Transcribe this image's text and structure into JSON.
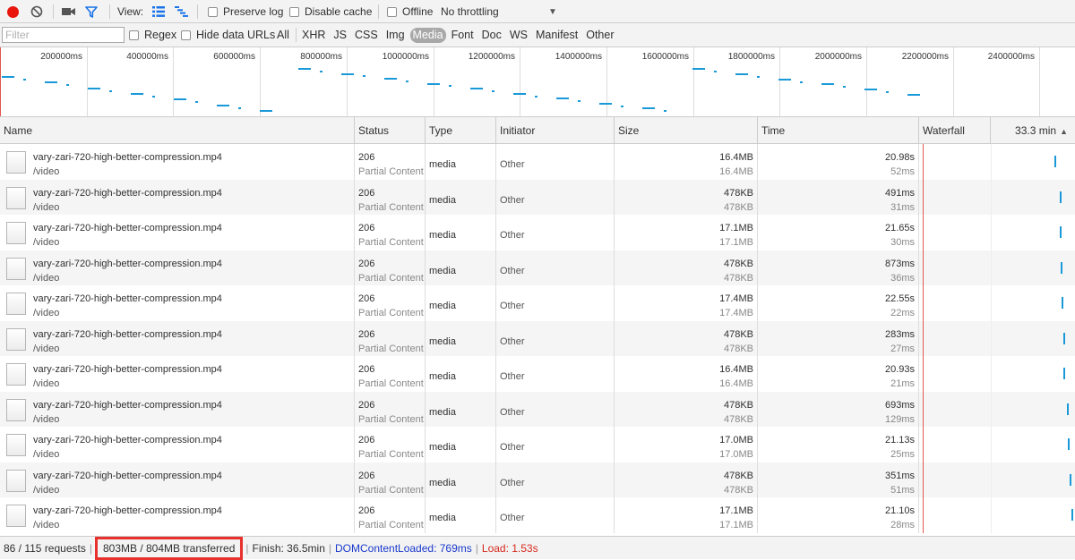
{
  "toolbar": {
    "view_label": "View:",
    "preserve_log_label": "Preserve log",
    "disable_cache_label": "Disable cache",
    "offline_label": "Offline",
    "throttling_value": "No throttling"
  },
  "filter_bar": {
    "filter_placeholder": "Filter",
    "regex_label": "Regex",
    "hide_data_urls_label": "Hide data URLs",
    "type_filters": [
      "All",
      "XHR",
      "JS",
      "CSS",
      "Img",
      "Media",
      "Font",
      "Doc",
      "WS",
      "Manifest",
      "Other"
    ],
    "active_type": "Media"
  },
  "overview": {
    "ticks": [
      "200000ms",
      "400000ms",
      "600000ms",
      "800000ms",
      "1000000ms",
      "1200000ms",
      "1400000ms",
      "1600000ms",
      "1800000ms",
      "2000000ms",
      "2200000ms",
      "2400000ms"
    ]
  },
  "table": {
    "columns": {
      "name": "Name",
      "status": "Status",
      "type": "Type",
      "initiator": "Initiator",
      "size": "Size",
      "time": "Time",
      "waterfall": "Waterfall",
      "duration": "33.3 min"
    },
    "rows": [
      {
        "name": "vary-zari-720-high-better-compression.mp4",
        "path": "/video",
        "status": "206",
        "status_text": "Partial Content",
        "type": "media",
        "initiator": "Other",
        "size": "16.4MB",
        "content": "16.4MB",
        "time": "20.98s",
        "latency": "52ms"
      },
      {
        "name": "vary-zari-720-high-better-compression.mp4",
        "path": "/video",
        "status": "206",
        "status_text": "Partial Content",
        "type": "media",
        "initiator": "Other",
        "size": "478KB",
        "content": "478KB",
        "time": "491ms",
        "latency": "31ms"
      },
      {
        "name": "vary-zari-720-high-better-compression.mp4",
        "path": "/video",
        "status": "206",
        "status_text": "Partial Content",
        "type": "media",
        "initiator": "Other",
        "size": "17.1MB",
        "content": "17.1MB",
        "time": "21.65s",
        "latency": "30ms"
      },
      {
        "name": "vary-zari-720-high-better-compression.mp4",
        "path": "/video",
        "status": "206",
        "status_text": "Partial Content",
        "type": "media",
        "initiator": "Other",
        "size": "478KB",
        "content": "478KB",
        "time": "873ms",
        "latency": "36ms"
      },
      {
        "name": "vary-zari-720-high-better-compression.mp4",
        "path": "/video",
        "status": "206",
        "status_text": "Partial Content",
        "type": "media",
        "initiator": "Other",
        "size": "17.4MB",
        "content": "17.4MB",
        "time": "22.55s",
        "latency": "22ms"
      },
      {
        "name": "vary-zari-720-high-better-compression.mp4",
        "path": "/video",
        "status": "206",
        "status_text": "Partial Content",
        "type": "media",
        "initiator": "Other",
        "size": "478KB",
        "content": "478KB",
        "time": "283ms",
        "latency": "27ms"
      },
      {
        "name": "vary-zari-720-high-better-compression.mp4",
        "path": "/video",
        "status": "206",
        "status_text": "Partial Content",
        "type": "media",
        "initiator": "Other",
        "size": "16.4MB",
        "content": "16.4MB",
        "time": "20.93s",
        "latency": "21ms"
      },
      {
        "name": "vary-zari-720-high-better-compression.mp4",
        "path": "/video",
        "status": "206",
        "status_text": "Partial Content",
        "type": "media",
        "initiator": "Other",
        "size": "478KB",
        "content": "478KB",
        "time": "693ms",
        "latency": "129ms"
      },
      {
        "name": "vary-zari-720-high-better-compression.mp4",
        "path": "/video",
        "status": "206",
        "status_text": "Partial Content",
        "type": "media",
        "initiator": "Other",
        "size": "17.0MB",
        "content": "17.0MB",
        "time": "21.13s",
        "latency": "25ms"
      },
      {
        "name": "vary-zari-720-high-better-compression.mp4",
        "path": "/video",
        "status": "206",
        "status_text": "Partial Content",
        "type": "media",
        "initiator": "Other",
        "size": "478KB",
        "content": "478KB",
        "time": "351ms",
        "latency": "51ms"
      },
      {
        "name": "vary-zari-720-high-better-compression.mp4",
        "path": "/video",
        "status": "206",
        "status_text": "Partial Content",
        "type": "media",
        "initiator": "Other",
        "size": "17.1MB",
        "content": "17.1MB",
        "time": "21.10s",
        "latency": "28ms"
      }
    ]
  },
  "status_bar": {
    "requests": "86 / 115 requests",
    "transferred": "803MB / 804MB transferred",
    "finish": "Finish: 36.5min",
    "dom_content_loaded": "DOMContentLoaded: 769ms",
    "load": "Load: 1.53s"
  },
  "colors": {
    "record": "#e8160d",
    "accent_blue": "#1a99d8",
    "highlight_box": "#e8302c",
    "dom_loaded": "#1a39cc",
    "load": "#d62a1e"
  }
}
